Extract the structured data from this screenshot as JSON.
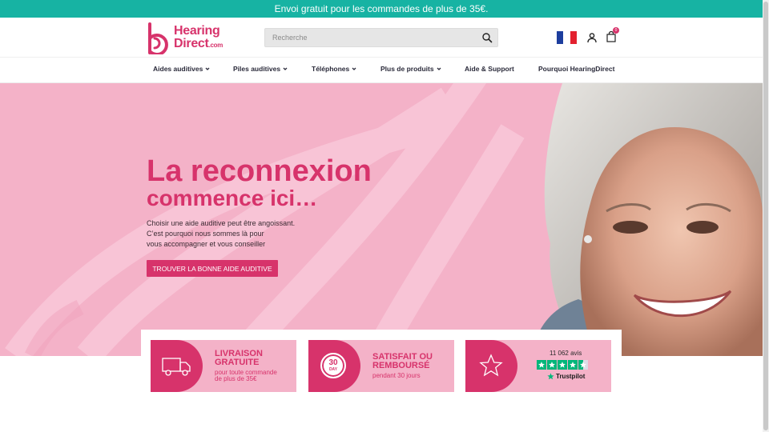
{
  "promo": {
    "text": "Envoi gratuit pour les commandes de plus de 35€."
  },
  "logo": {
    "line1": "Hearing",
    "line2": "Direct",
    "suffix": ".com"
  },
  "search": {
    "placeholder": "Recherche"
  },
  "cart": {
    "count": "0"
  },
  "nav": {
    "items": [
      {
        "label": "Aides auditives"
      },
      {
        "label": "Piles auditives"
      },
      {
        "label": "Téléphones"
      },
      {
        "label": "Plus de produits"
      },
      {
        "label": "Aide & Support"
      },
      {
        "label": "Pourquoi HearingDirect"
      }
    ]
  },
  "hero": {
    "title_line1": "La reconnexion",
    "title_line2": "commence ici…",
    "copy_line1": "Choisir une aide auditive peut être angoissant.",
    "copy_line2": "C’est pourquoi nous sommes là pour",
    "copy_line3": "vous accompagner et vous conseiller",
    "cta": "TROUVER LA BONNE AIDE AUDITIVE"
  },
  "features": {
    "delivery": {
      "title_line1": "LIVRAISON",
      "title_line2": "GRATUITE",
      "sub_line1": "pour toute commande",
      "sub_line2": "de plus de 35€"
    },
    "refund": {
      "badge_number": "30",
      "badge_unit": "DAY",
      "title_line1": "SATISFAIT OU",
      "title_line2": "REMBOURSÉ",
      "sub": "pendant 30 jours"
    },
    "reviews": {
      "count": "11 062 avis",
      "rating_stars": 4.5,
      "brand": "Trustpilot"
    }
  },
  "colors": {
    "brand_pink": "#d7336b",
    "light_pink": "#f4b2c8",
    "teal": "#17b3a3",
    "trustpilot_green": "#00b67a"
  }
}
